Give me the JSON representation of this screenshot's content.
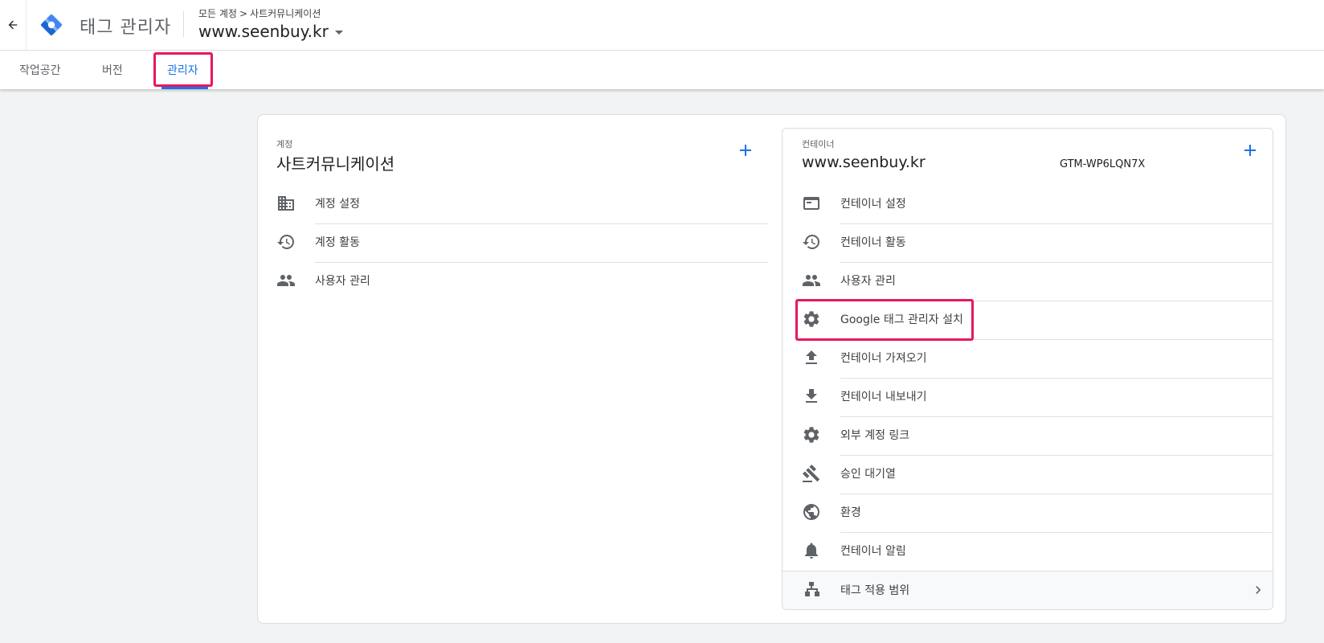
{
  "header": {
    "back_icon": "arrow-back-icon",
    "logo_icon": "tag-manager-logo",
    "app_title": "태그 관리자",
    "breadcrumb": {
      "all_accounts": "모든 계정",
      "separator": ">",
      "account": "사트커뮤니케이션"
    },
    "container_name": "www.seenbuy.kr"
  },
  "tabs": [
    {
      "label": "작업공간",
      "active": false
    },
    {
      "label": "버전",
      "active": false
    },
    {
      "label": "관리자",
      "active": true
    }
  ],
  "account": {
    "label": "계정",
    "name": "사트커뮤니케이션",
    "add_icon": "plus-icon",
    "items": [
      {
        "label": "계정 설정",
        "icon": "building-icon"
      },
      {
        "label": "계정 활동",
        "icon": "history-icon"
      },
      {
        "label": "사용자 관리",
        "icon": "people-icon"
      }
    ]
  },
  "container": {
    "label": "컨테이너",
    "name": "www.seenbuy.kr",
    "id": "GTM-WP6LQN7X",
    "add_icon": "plus-icon",
    "items": [
      {
        "label": "컨테이너 설정",
        "icon": "web-asset-icon"
      },
      {
        "label": "컨테이너 활동",
        "icon": "history-icon"
      },
      {
        "label": "사용자 관리",
        "icon": "people-icon"
      },
      {
        "label": "Google 태그 관리자 설치",
        "icon": "gear-icon"
      },
      {
        "label": "컨테이너 가져오기",
        "icon": "upload-icon"
      },
      {
        "label": "컨테이너 내보내기",
        "icon": "download-icon"
      },
      {
        "label": "외부 계정 링크",
        "icon": "gear-icon"
      },
      {
        "label": "승인 대기열",
        "icon": "gavel-icon"
      },
      {
        "label": "환경",
        "icon": "globe-icon"
      },
      {
        "label": "컨테이너 알림",
        "icon": "bell-icon"
      },
      {
        "label": "태그 적용 범위",
        "icon": "hierarchy-icon"
      }
    ]
  },
  "colors": {
    "accent": "#1a73e8",
    "highlight": "#e8175d",
    "icon": "#5f6368"
  }
}
